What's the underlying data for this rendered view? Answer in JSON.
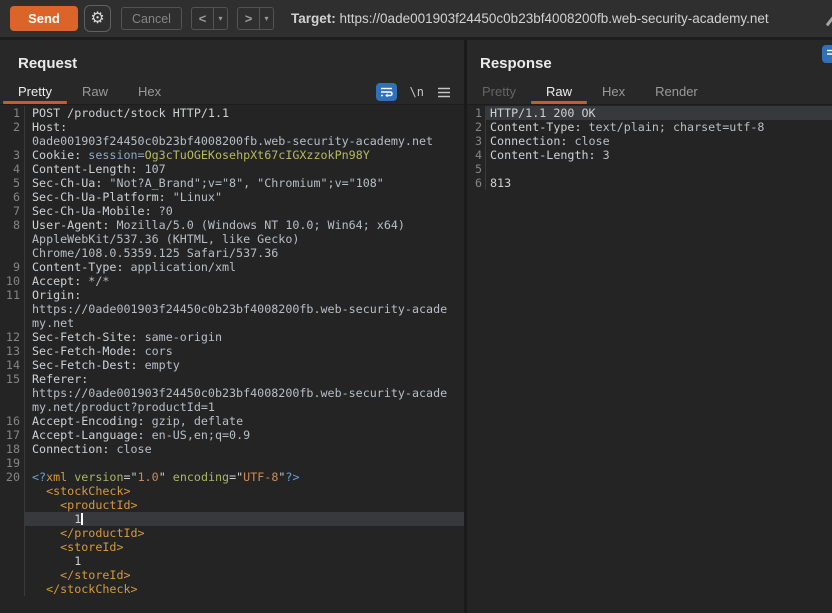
{
  "toolbar": {
    "send_label": "Send",
    "cancel_label": "Cancel",
    "back_label": "<",
    "forward_label": ">",
    "dropdown_glyph": "▾",
    "target_label": "Target:",
    "target_url": "https://0ade001903f24450c0b23bf4008200fb.web-security-academy.net"
  },
  "colors": {
    "accent_orange": "#dd6428",
    "tab_underline": "#c75c2c",
    "icon_blue": "#3071b8",
    "cookie_name": "#8fa8c8",
    "cookie_value": "#b4bb60",
    "xml_tag": "#d6993f",
    "xml_attr": "#aab566",
    "xml_value": "#cd8b52",
    "xml_delim": "#6a9fd8"
  },
  "request_panel": {
    "title": "Request",
    "tabs": [
      {
        "label": "Pretty",
        "state": "selected"
      },
      {
        "label": "Raw",
        "state": "normal"
      },
      {
        "label": "Hex",
        "state": "normal"
      }
    ],
    "newline_icon_glyph": "\\n",
    "lines": [
      {
        "n": "1",
        "s": [
          [
            "t",
            "POST /product/stock HTTP/1.1"
          ]
        ]
      },
      {
        "n": "2",
        "s": [
          [
            "t",
            "Host:"
          ]
        ]
      },
      {
        "n": "",
        "s": [
          [
            "v",
            "0ade001903f24450c0b23bf4008200fb.web-security-academy.net"
          ]
        ]
      },
      {
        "n": "3",
        "s": [
          [
            "t",
            "Cookie: "
          ],
          [
            "ck",
            "session="
          ],
          [
            "cv",
            "Og3cTuOGEKosehpXt67cIGXzzokPn98Y"
          ]
        ]
      },
      {
        "n": "4",
        "s": [
          [
            "t",
            "Content-Length:"
          ],
          [
            "v",
            " 107"
          ]
        ]
      },
      {
        "n": "5",
        "s": [
          [
            "t",
            "Sec-Ch-Ua:"
          ],
          [
            "v",
            " \"Not?A_Brand\";v=\"8\", \"Chromium\";v=\"108\""
          ]
        ]
      },
      {
        "n": "6",
        "s": [
          [
            "t",
            "Sec-Ch-Ua-Platform:"
          ],
          [
            "v",
            " \"Linux\""
          ]
        ]
      },
      {
        "n": "7",
        "s": [
          [
            "t",
            "Sec-Ch-Ua-Mobile:"
          ],
          [
            "v",
            " ?0"
          ]
        ]
      },
      {
        "n": "8",
        "s": [
          [
            "t",
            "User-Agent:"
          ],
          [
            "v",
            " Mozilla/5.0 (Windows NT 10.0; Win64; x64)"
          ]
        ]
      },
      {
        "n": "",
        "s": [
          [
            "v",
            "AppleWebKit/537.36 (KHTML, like Gecko)"
          ]
        ]
      },
      {
        "n": "",
        "s": [
          [
            "v",
            "Chrome/108.0.5359.125 Safari/537.36"
          ]
        ]
      },
      {
        "n": "9",
        "s": [
          [
            "t",
            "Content-Type:"
          ],
          [
            "v",
            " application/xml"
          ]
        ]
      },
      {
        "n": "10",
        "s": [
          [
            "t",
            "Accept:"
          ],
          [
            "v",
            " */*"
          ]
        ]
      },
      {
        "n": "11",
        "s": [
          [
            "t",
            "Origin:"
          ]
        ]
      },
      {
        "n": "",
        "s": [
          [
            "v",
            "https://0ade001903f24450c0b23bf4008200fb.web-security-acade"
          ]
        ]
      },
      {
        "n": "",
        "s": [
          [
            "v",
            "my.net"
          ]
        ]
      },
      {
        "n": "12",
        "s": [
          [
            "t",
            "Sec-Fetch-Site:"
          ],
          [
            "v",
            " same-origin"
          ]
        ]
      },
      {
        "n": "13",
        "s": [
          [
            "t",
            "Sec-Fetch-Mode:"
          ],
          [
            "v",
            " cors"
          ]
        ]
      },
      {
        "n": "14",
        "s": [
          [
            "t",
            "Sec-Fetch-Dest:"
          ],
          [
            "v",
            " empty"
          ]
        ]
      },
      {
        "n": "15",
        "s": [
          [
            "t",
            "Referer:"
          ]
        ]
      },
      {
        "n": "",
        "s": [
          [
            "v",
            "https://0ade001903f24450c0b23bf4008200fb.web-security-acade"
          ]
        ]
      },
      {
        "n": "",
        "s": [
          [
            "v",
            "my.net/product?productId=1"
          ]
        ]
      },
      {
        "n": "16",
        "s": [
          [
            "t",
            "Accept-Encoding:"
          ],
          [
            "v",
            " gzip, deflate"
          ]
        ]
      },
      {
        "n": "17",
        "s": [
          [
            "t",
            "Accept-Language:"
          ],
          [
            "v",
            " en-US,en;q=0.9"
          ]
        ]
      },
      {
        "n": "18",
        "s": [
          [
            "t",
            "Connection:"
          ],
          [
            "v",
            " close"
          ]
        ]
      },
      {
        "n": "19",
        "s": []
      },
      {
        "n": "20",
        "s": [
          [
            "xd",
            "<?"
          ],
          [
            "xt",
            "xml"
          ],
          [
            "t",
            " "
          ],
          [
            "xa",
            "version"
          ],
          [
            "t",
            "=\""
          ],
          [
            "xv",
            "1.0"
          ],
          [
            "t",
            "\" "
          ],
          [
            "xa",
            "encoding"
          ],
          [
            "t",
            "=\""
          ],
          [
            "xv",
            "UTF-8"
          ],
          [
            "t",
            "\""
          ],
          [
            "xd",
            "?>"
          ]
        ]
      },
      {
        "n": "",
        "s": [
          [
            "xt",
            "  <stockCheck>"
          ]
        ]
      },
      {
        "n": "",
        "s": [
          [
            "xt",
            "    <productId>"
          ]
        ]
      },
      {
        "n": "",
        "s": [
          [
            "t",
            "      1"
          ]
        ],
        "hl": true,
        "caret": true
      },
      {
        "n": "",
        "s": [
          [
            "xt",
            "    </productId>"
          ]
        ]
      },
      {
        "n": "",
        "s": [
          [
            "xt",
            "    <storeId>"
          ]
        ]
      },
      {
        "n": "",
        "s": [
          [
            "t",
            "      1"
          ]
        ]
      },
      {
        "n": "",
        "s": [
          [
            "xt",
            "    </storeId>"
          ]
        ]
      },
      {
        "n": "",
        "s": [
          [
            "xt",
            "  </stockCheck>"
          ]
        ]
      }
    ]
  },
  "response_panel": {
    "title": "Response",
    "tabs": [
      {
        "label": "Pretty",
        "state": "disabled"
      },
      {
        "label": "Raw",
        "state": "selected"
      },
      {
        "label": "Hex",
        "state": "normal"
      },
      {
        "label": "Render",
        "state": "normal"
      }
    ],
    "lines": [
      {
        "n": "1",
        "s": [
          [
            "t",
            "HTTP/1.1 200 OK"
          ]
        ],
        "hl": true
      },
      {
        "n": "2",
        "s": [
          [
            "t",
            "Content-Type:"
          ],
          [
            "v",
            " text/plain; charset=utf-8"
          ]
        ]
      },
      {
        "n": "3",
        "s": [
          [
            "t",
            "Connection:"
          ],
          [
            "v",
            " close"
          ]
        ]
      },
      {
        "n": "4",
        "s": [
          [
            "t",
            "Content-Length:"
          ],
          [
            "v",
            " 3"
          ]
        ]
      },
      {
        "n": "5",
        "s": []
      },
      {
        "n": "6",
        "s": [
          [
            "t",
            "813"
          ]
        ]
      }
    ]
  }
}
